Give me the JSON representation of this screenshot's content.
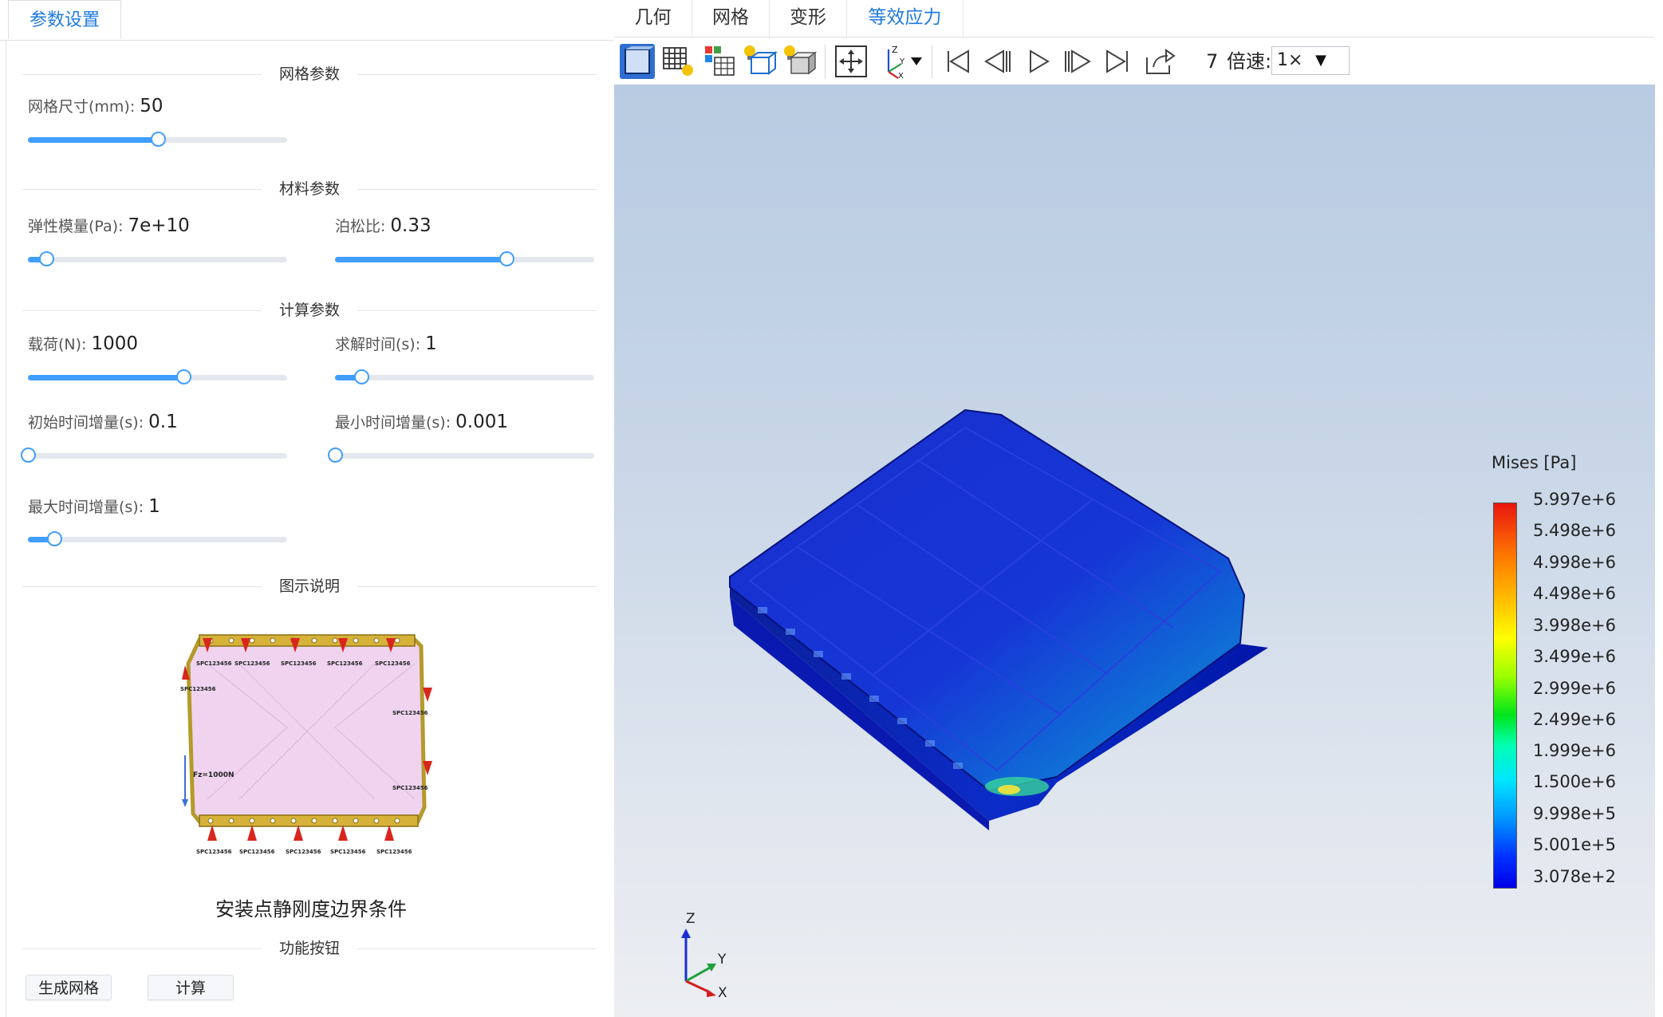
{
  "left_panel": {
    "tab_label": "参数设置",
    "sections": {
      "mesh": "网格参数",
      "material": "材料参数",
      "compute": "计算参数",
      "legend": "图示说明",
      "actions": "功能按钮"
    },
    "params": {
      "mesh_size": {
        "label": "网格尺寸(mm):",
        "value": "50",
        "fraction": 0.5
      },
      "elastic_modulus": {
        "label": "弹性模量(Pa):",
        "value": "7e+10",
        "fraction": 0.07
      },
      "poisson_ratio": {
        "label": "泊松比:",
        "value": "0.33",
        "fraction": 0.66
      },
      "load": {
        "label": "载荷(N):",
        "value": "1000",
        "fraction": 0.6
      },
      "solve_time": {
        "label": "求解时间(s):",
        "value": "1",
        "fraction": 0.1
      },
      "initial_increment": {
        "label": "初始时间增量(s):",
        "value": "0.1",
        "fraction": 0.0
      },
      "min_increment": {
        "label": "最小时间增量(s):",
        "value": "0.001",
        "fraction": 0.0
      },
      "max_increment": {
        "label": "最大时间增量(s):",
        "value": "1",
        "fraction": 0.1
      }
    },
    "figure": {
      "caption": "安装点静刚度边界条件",
      "spc_label": "SPC123456",
      "force_label": "Fz=1000N"
    },
    "buttons": {
      "generate_mesh": "生成网格",
      "compute": "计算"
    }
  },
  "right_panel": {
    "tabs": [
      {
        "label": "几何"
      },
      {
        "label": "网格"
      },
      {
        "label": "变形"
      },
      {
        "label": "等效应力"
      }
    ],
    "active_tab": "等效应力",
    "toolbar": {
      "frame": "7",
      "speed_label": "倍速:",
      "speed_value": "1×"
    },
    "viewport": {
      "legend_title": "Mises [Pa]",
      "legend_values": [
        "5.997e+6",
        "5.498e+6",
        "4.998e+6",
        "4.498e+6",
        "3.998e+6",
        "3.499e+6",
        "2.999e+6",
        "2.499e+6",
        "1.999e+6",
        "1.500e+6",
        "9.998e+5",
        "5.001e+5",
        "3.078e+2"
      ],
      "axes": {
        "z": "Z",
        "y": "Y",
        "x": "X"
      }
    },
    "colors": {
      "accent": "#1f7ae0",
      "slider": "#409eff"
    }
  }
}
